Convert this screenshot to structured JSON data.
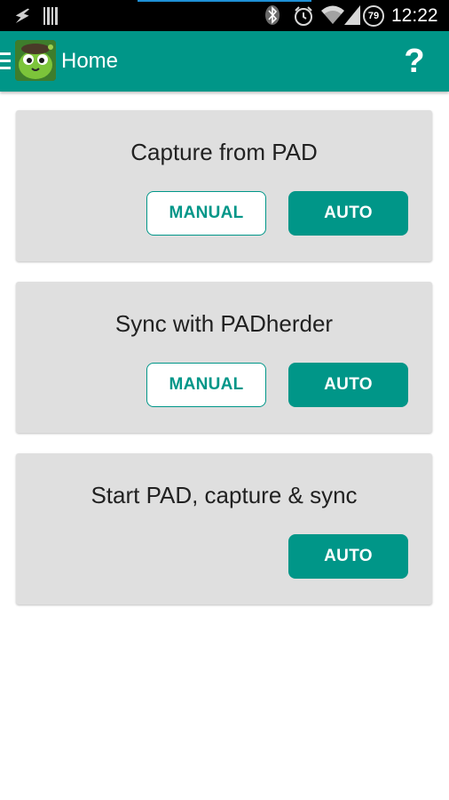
{
  "status_bar": {
    "time": "12:22",
    "battery_level": "79",
    "icons": [
      "charging-bolt-icon",
      "barcode-icon",
      "bluetooth-icon",
      "alarm-icon",
      "wifi-icon",
      "signal-icon",
      "battery-icon"
    ]
  },
  "app_bar": {
    "title": "Home",
    "help_label": "?",
    "logo": "app-logo-icon",
    "menu_icon": "hamburger-menu-icon"
  },
  "colors": {
    "primary": "#009688",
    "card_background": "#dfdfdf",
    "status_bar": "#000000"
  },
  "cards": [
    {
      "title": "Capture from PAD",
      "manual_label": "MANUAL",
      "auto_label": "AUTO"
    },
    {
      "title": "Sync with PADherder",
      "manual_label": "MANUAL",
      "auto_label": "AUTO"
    },
    {
      "title": "Start PAD, capture & sync",
      "auto_label": "AUTO"
    }
  ]
}
